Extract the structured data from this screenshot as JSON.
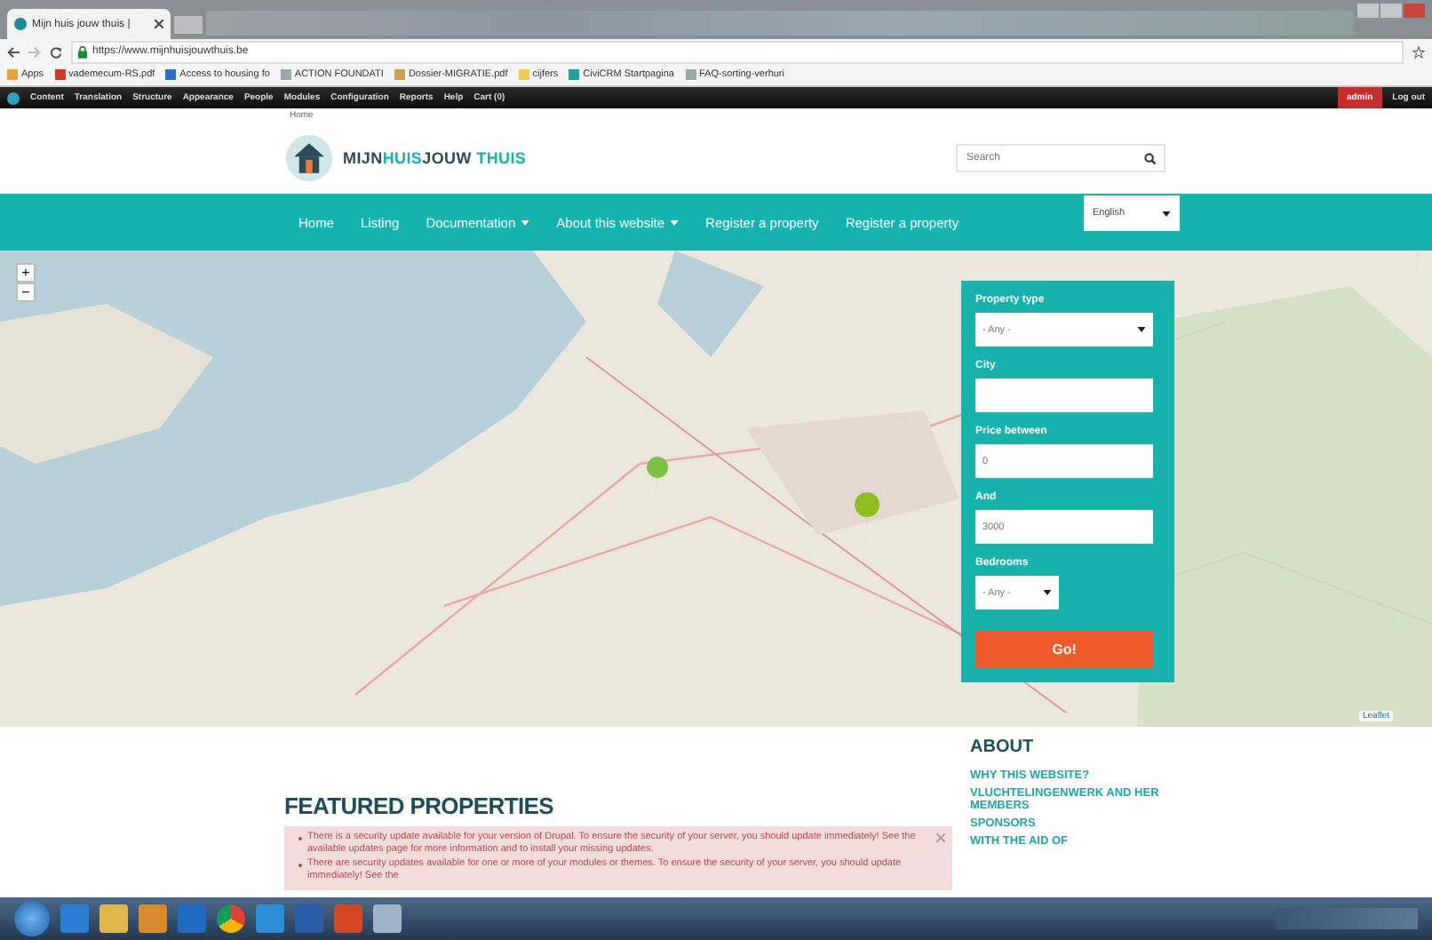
{
  "browser": {
    "tab_title": "Mijn huis jouw thuis |",
    "url": "https://www.mijnhuisjouwthuis.be",
    "bookmarks": [
      {
        "label": "Apps",
        "kind": "apps"
      },
      {
        "label": "vademecum-RS.pdf",
        "kind": "pdf"
      },
      {
        "label": "Access to housing fo",
        "kind": "doc"
      },
      {
        "label": "ACTION FOUNDATI",
        "kind": "page"
      },
      {
        "label": "Dossier-MIGRATIE.pdf",
        "kind": "file"
      },
      {
        "label": "cijfers",
        "kind": "folder"
      },
      {
        "label": "CiviCRM Startpagina",
        "kind": "site"
      },
      {
        "label": "FAQ-sorting-verhuri",
        "kind": "page"
      }
    ]
  },
  "admin_toolbar": {
    "items": [
      "Content",
      "Translation",
      "Structure",
      "Appearance",
      "People",
      "Modules",
      "Configuration",
      "Reports",
      "Help",
      "Cart (0)"
    ],
    "user": "admin",
    "logout": "Log out"
  },
  "breadcrumb": "Home",
  "logo": {
    "parts": [
      {
        "text": "MIJN",
        "color": "#2c4a5c"
      },
      {
        "text": "HUIS",
        "color": "#1bb3ad"
      },
      {
        "text": "JOUW",
        "color": "#2c4a5c"
      },
      {
        "text": "THUIS",
        "color": "#1bb3ad"
      }
    ]
  },
  "search": {
    "placeholder": "Search"
  },
  "nav": [
    {
      "label": "Home",
      "dropdown": false
    },
    {
      "label": "Listing",
      "dropdown": false
    },
    {
      "label": "Documentation",
      "dropdown": true
    },
    {
      "label": "About this website",
      "dropdown": true
    },
    {
      "label": "Register a property",
      "dropdown": false
    },
    {
      "label": "Register a property",
      "dropdown": false
    }
  ],
  "language": "English",
  "map": {
    "zoom_in": "+",
    "zoom_out": "−",
    "attribution": "Leaflet"
  },
  "search_form": {
    "fields": [
      {
        "label": "Property type",
        "kind": "select",
        "value": "- Any -"
      },
      {
        "label": "City",
        "kind": "text"
      },
      {
        "label": "Price between",
        "kind": "text",
        "value": "0"
      },
      {
        "label": "And",
        "kind": "text",
        "value": "3000"
      },
      {
        "label": "Bedrooms",
        "kind": "select-small",
        "value": "- Any -"
      }
    ],
    "submit": "Go!"
  },
  "featured_heading": "FEATURED PROPERTIES",
  "messages": [
    "There is a security update available for your version of Drupal. To ensure the security of your server, you should update immediately! See the available updates page for more information and to install your missing updates.",
    "There are security updates available for one or more of your modules or themes. To ensure the security of your server, you should update immediately! See the"
  ],
  "about": {
    "heading": "ABOUT",
    "links": [
      "WHY THIS WEBSITE?",
      "VLUCHTELINGENWERK AND HER MEMBERS",
      "SPONSORS",
      "WITH THE AID OF"
    ]
  }
}
